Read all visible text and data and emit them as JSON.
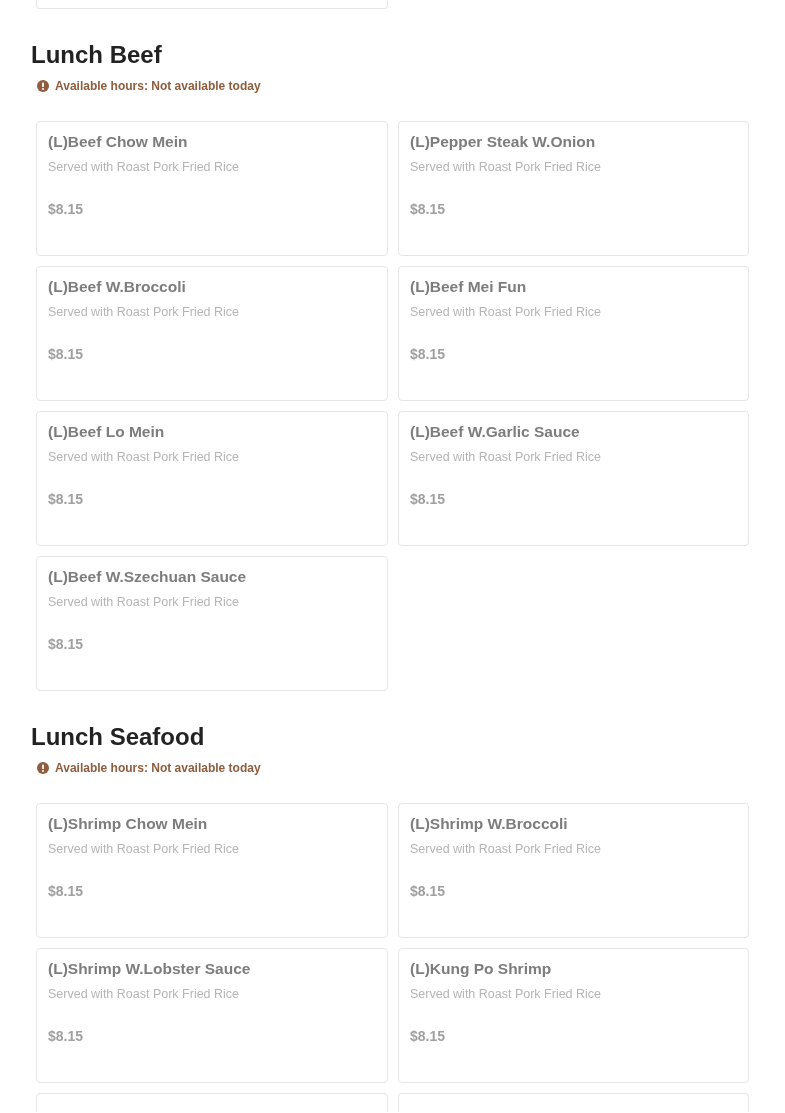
{
  "sections": [
    {
      "title": "Lunch Beef",
      "availability": "Available hours: Not available today",
      "items": [
        {
          "name": "(L)Beef Chow Mein",
          "description": "Served with Roast Pork Fried Rice",
          "price": "$8.15"
        },
        {
          "name": "(L)Pepper Steak W.Onion",
          "description": "Served with Roast Pork Fried Rice",
          "price": "$8.15"
        },
        {
          "name": "(L)Beef W.Broccoli",
          "description": "Served with Roast Pork Fried Rice",
          "price": "$8.15"
        },
        {
          "name": "(L)Beef Mei Fun",
          "description": "Served with Roast Pork Fried Rice",
          "price": "$8.15"
        },
        {
          "name": "(L)Beef Lo Mein",
          "description": "Served with Roast Pork Fried Rice",
          "price": "$8.15"
        },
        {
          "name": "(L)Beef W.Garlic Sauce",
          "description": "Served with Roast Pork Fried Rice",
          "price": "$8.15"
        },
        {
          "name": "(L)Beef W.Szechuan Sauce",
          "description": "Served with Roast Pork Fried Rice",
          "price": "$8.15"
        }
      ]
    },
    {
      "title": "Lunch Seafood",
      "availability": "Available hours: Not available today",
      "items": [
        {
          "name": "(L)Shrimp Chow Mein",
          "description": "Served with Roast Pork Fried Rice",
          "price": "$8.15"
        },
        {
          "name": "(L)Shrimp W.Broccoli",
          "description": "Served with Roast Pork Fried Rice",
          "price": "$8.15"
        },
        {
          "name": "(L)Shrimp W.Lobster Sauce",
          "description": "Served with Roast Pork Fried Rice",
          "price": "$8.15"
        },
        {
          "name": "(L)Kung Po Shrimp",
          "description": "Served with Roast Pork Fried Rice",
          "price": "$8.15"
        }
      ]
    }
  ]
}
